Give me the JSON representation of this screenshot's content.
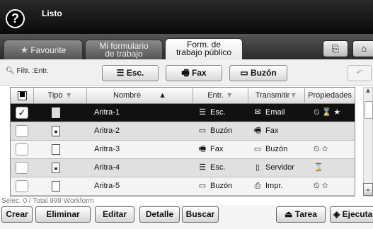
{
  "header": {
    "help_glyph": "?",
    "status": "Listo"
  },
  "tabs": [
    {
      "label_line1": "Favourite",
      "label_line2": ""
    },
    {
      "label_line1": "Mi formulario",
      "label_line2": "de trabajo"
    },
    {
      "label_line1": "Form. de",
      "label_line2": "trabajo público"
    }
  ],
  "filter": {
    "label": "Filtr. :Entr.",
    "buttons": [
      "Esc.",
      "Fax",
      "Buzón"
    ]
  },
  "table": {
    "headers": [
      "Tipo",
      "Nombre",
      "Entr.",
      "Transmitir",
      "Propiedades"
    ],
    "rows": [
      {
        "type": "doc",
        "name": "Aritra-1",
        "entry": "Esc.",
        "entry_icon": "scanner-icon",
        "transmit": "Email",
        "transmit_icon": "email-icon",
        "props": "⏲ ⌛ ★",
        "checked": true
      },
      {
        "type": "locked-doc",
        "name": "Aritra-2",
        "entry": "Buzón",
        "entry_icon": "mailbox-icon",
        "transmit": "Fax",
        "transmit_icon": "fax-icon",
        "props": "",
        "checked": false
      },
      {
        "type": "doc",
        "name": "Aritra-3",
        "entry": "Fax",
        "entry_icon": "fax-icon",
        "transmit": "Buzón",
        "transmit_icon": "mailbox-icon",
        "props": "⏲ ☆",
        "checked": false
      },
      {
        "type": "locked-doc",
        "name": "Aritra-4",
        "entry": "Esc.",
        "entry_icon": "scanner-icon",
        "transmit": "Servidor",
        "transmit_icon": "server-icon",
        "props": "⌛",
        "checked": false
      },
      {
        "type": "doc",
        "name": "Aritra-5",
        "entry": "Buzón",
        "entry_icon": "mailbox-icon",
        "transmit": "Impr.",
        "transmit_icon": "printer-icon",
        "props": "⏲ ☆",
        "checked": false
      }
    ]
  },
  "selection_info": "Selec. 0 / Total 999 Workform",
  "bottom_buttons": {
    "create": "Crear",
    "delete": "Eliminar",
    "edit": "Editar",
    "detail": "Detalle",
    "search": "Buscar",
    "task": "Tarea",
    "execute": "Ejecutar"
  },
  "colors": {
    "header_bg": "#111111",
    "selected_row": "#111111"
  }
}
